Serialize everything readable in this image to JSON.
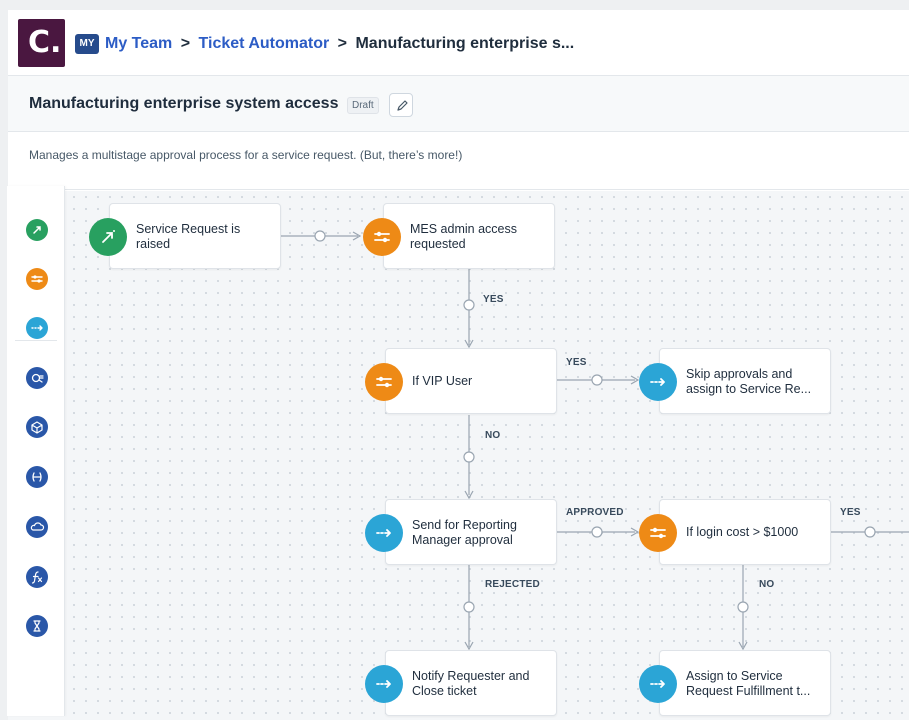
{
  "header": {
    "logo_text": "C.",
    "workspace_badge": "MY",
    "breadcrumbs": [
      "My Team",
      "Ticket Automator",
      "Manufacturing enterprise s..."
    ],
    "separator": ">"
  },
  "workflow": {
    "title": "Manufacturing enterprise system access",
    "status": "Draft",
    "description": "Manages a multistage approval process for a service request. (But, there’s more!)"
  },
  "palette": {
    "items": [
      "event-icon",
      "condition-icon",
      "action-icon",
      "query-icon",
      "app-icon",
      "webhook-icon",
      "cloud-icon",
      "expression-icon",
      "timer-icon"
    ]
  },
  "nodes": [
    {
      "id": "event",
      "label": "Service Request is raised",
      "icon": "event-icon",
      "color": "#28a060"
    },
    {
      "id": "mes-condition",
      "label": "MES admin access requested",
      "icon": "condition-icon",
      "color": "#ee8a16"
    },
    {
      "id": "vip-condition",
      "label": "If VIP User",
      "icon": "condition-icon",
      "color": "#ee8a16"
    },
    {
      "id": "skip-action",
      "label": "Skip approvals and assign to Service Re...",
      "icon": "action-icon",
      "color": "#2ba5d6"
    },
    {
      "id": "approval-action",
      "label": "Send for Reporting Manager approval",
      "icon": "action-icon",
      "color": "#2ba5d6"
    },
    {
      "id": "cost-condition",
      "label": "If login cost > $1000",
      "icon": "condition-icon",
      "color": "#ee8a16"
    },
    {
      "id": "notify-action",
      "label": "Notify Requester and Close ticket",
      "icon": "action-icon",
      "color": "#2ba5d6"
    },
    {
      "id": "assign-action",
      "label": "Assign to Service Request Fulfillment t...",
      "icon": "action-icon",
      "color": "#2ba5d6"
    }
  ],
  "edge_labels": {
    "mes_yes": "YES",
    "vip_yes": "YES",
    "vip_no": "NO",
    "approved": "APPROVED",
    "rejected": "REJECTED",
    "cost_yes": "YES",
    "cost_no": "NO"
  }
}
